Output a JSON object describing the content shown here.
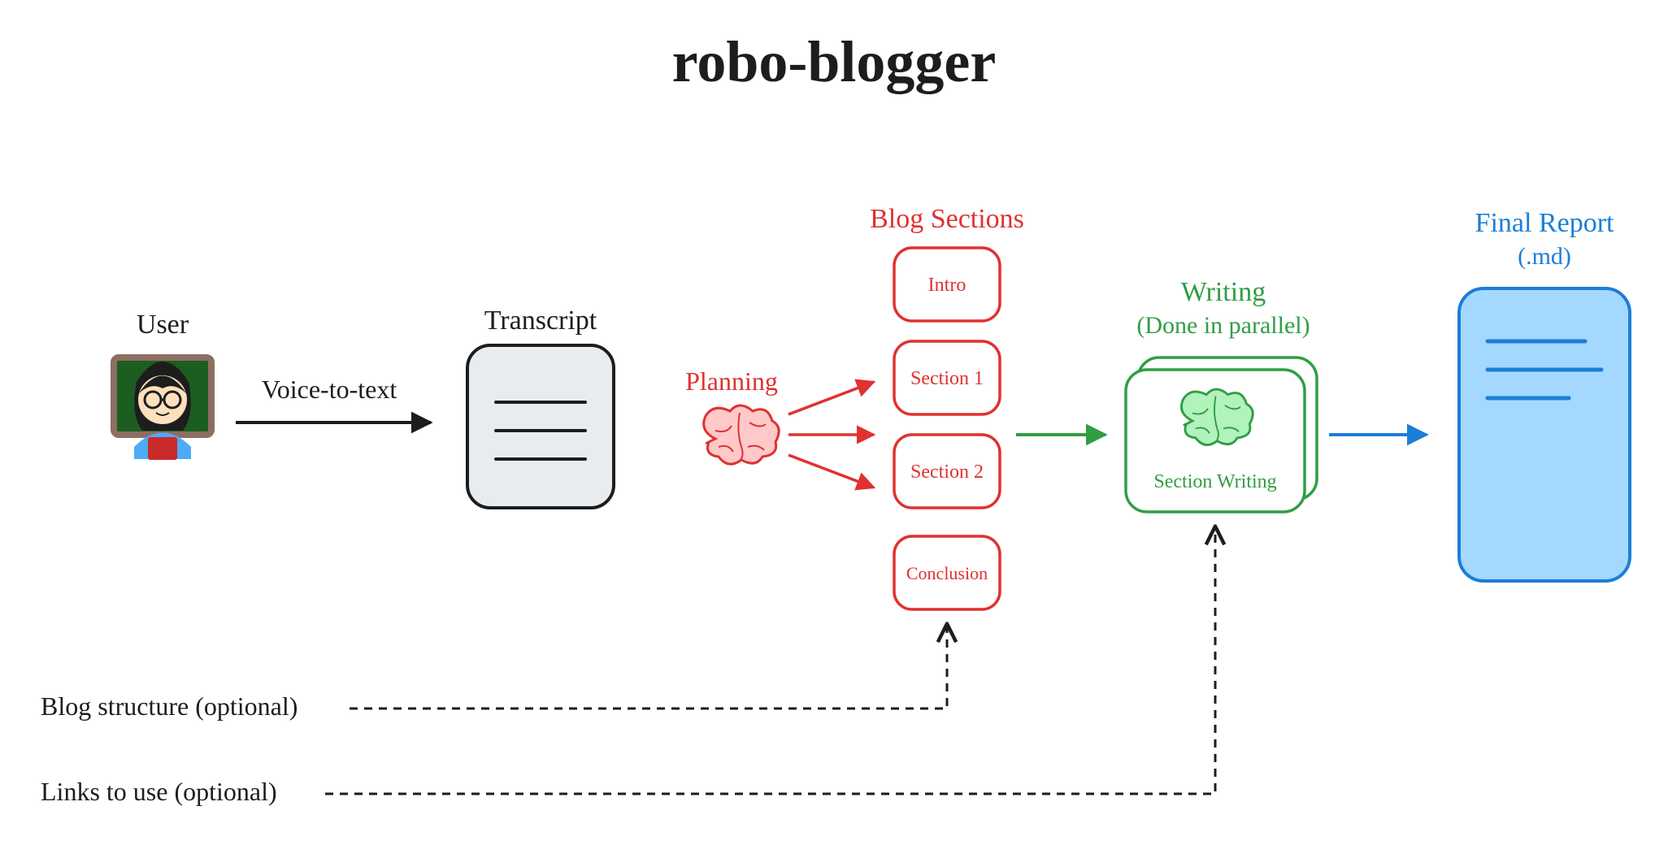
{
  "title": "robo-blogger",
  "labels": {
    "user": "User",
    "voice_to_text": "Voice-to-text",
    "transcript": "Transcript",
    "planning": "Planning",
    "blog_sections": "Blog Sections",
    "writing_line1": "Writing",
    "writing_line2": "(Done in parallel)",
    "section_writing": "Section Writing",
    "final_report_line1": "Final Report",
    "final_report_line2": "(.md)",
    "blog_structure_optional": "Blog structure (optional)",
    "links_to_use_optional": "Links to use (optional)"
  },
  "sections": {
    "intro": "Intro",
    "section1": "Section 1",
    "section2": "Section 2",
    "conclusion": "Conclusion"
  },
  "colors": {
    "black": "#1d1d1d",
    "red": "#e03131",
    "green": "#2f9e44",
    "blue": "#1c7ed6",
    "gray_fill": "#e9ecef",
    "blue_fill": "#a5d8ff",
    "brain_pink_fill": "#ffc9c9",
    "brain_green_fill": "#b2f2bb"
  },
  "diagram": {
    "flow": [
      "User (avatar)",
      "Voice-to-text arrow",
      "Transcript document",
      "Planning brain (red)",
      "Blog Sections: Intro, Section 1, Section 2, Conclusion",
      "Writing (Done in parallel) — Section Writing cards with green brain",
      "Final Report (.md) document"
    ],
    "optional_inputs": [
      "Blog structure (optional) → Blog Sections",
      "Links to use (optional) → Writing"
    ]
  }
}
